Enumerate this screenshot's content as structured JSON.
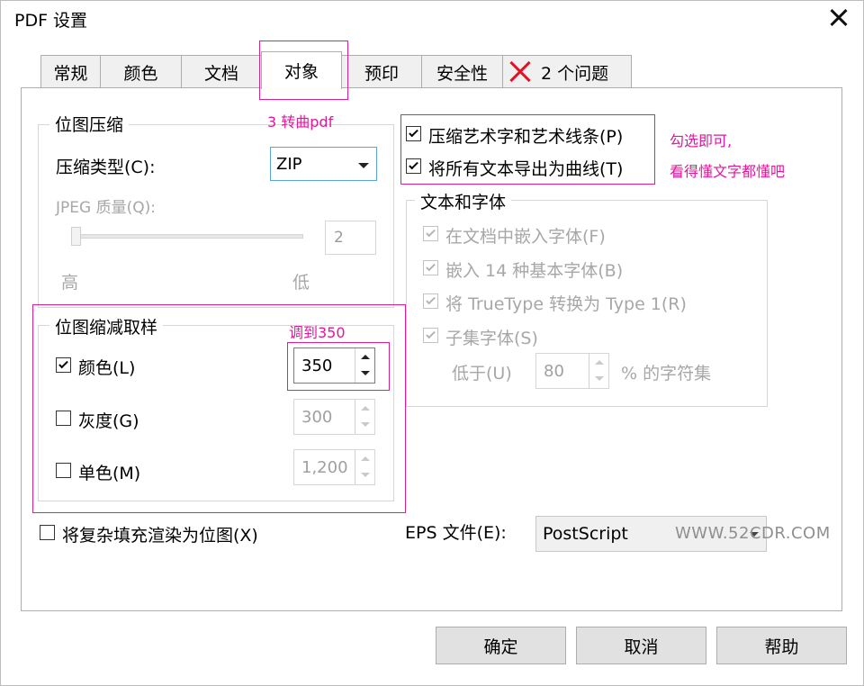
{
  "window": {
    "title": "PDF 设置"
  },
  "tabs": [
    {
      "label": "常规"
    },
    {
      "label": "颜色"
    },
    {
      "label": "文档"
    },
    {
      "label": "对象",
      "active": true
    },
    {
      "label": "预印"
    },
    {
      "label": "安全性"
    },
    {
      "label": "2 个问题",
      "icon": "error-x-icon"
    }
  ],
  "bitmap_compression": {
    "title": "位图压缩",
    "type_label": "压缩类型(C):",
    "type_value": "ZIP",
    "jpeg_label": "JPEG 质量(Q):",
    "jpeg_value": "2",
    "high_label": "高",
    "low_label": "低"
  },
  "downsample": {
    "title": "位图缩减取样",
    "rows": [
      {
        "label": "颜色(L)",
        "checked": true,
        "value": "350",
        "enabled": true
      },
      {
        "label": "灰度(G)",
        "checked": false,
        "value": "300",
        "enabled": false
      },
      {
        "label": "单色(M)",
        "checked": false,
        "value": "1,200",
        "enabled": false
      }
    ]
  },
  "complex_fill": {
    "label": "将复杂填充渲染为位图(X)",
    "checked": false
  },
  "text_options": [
    {
      "label": "压缩艺术字和艺术线条(P)",
      "checked": true
    },
    {
      "label": "将所有文本导出为曲线(T)",
      "checked": true
    }
  ],
  "fonts_group": {
    "title": "文本和字体",
    "items": [
      {
        "label": "在文档中嵌入字体(F)",
        "checked": true
      },
      {
        "label": "嵌入 14 种基本字体(B)",
        "checked": true
      },
      {
        "label": "将 TrueType 转换为 Type 1(R)",
        "checked": true
      },
      {
        "label": "子集字体(S)",
        "checked": true
      }
    ],
    "below_label": "低于(U)",
    "below_value": "80",
    "below_suffix": "% 的字符集"
  },
  "eps": {
    "label": "EPS 文件(E):",
    "value": "PostScript"
  },
  "buttons": {
    "ok": "确定",
    "cancel": "取消",
    "help": "帮助"
  },
  "annotations": {
    "step3": "3 转曲pdf",
    "set350": "调到350",
    "check_line1": "勾选即可,",
    "check_line2": "看得懂文字都懂吧"
  },
  "watermark": "WWW.52CDR.COM",
  "colors": {
    "annotation": "#e0189b",
    "error": "#e81123",
    "focus": "#5ba4d9"
  }
}
